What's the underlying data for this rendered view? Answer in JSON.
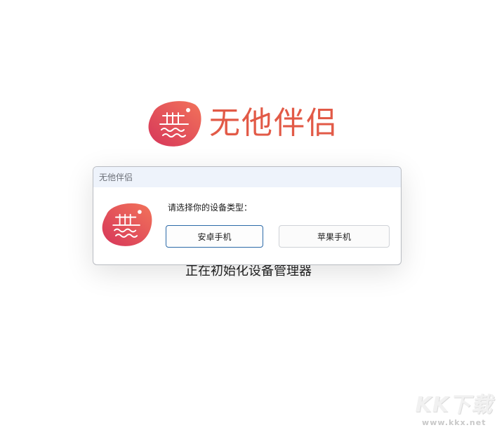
{
  "brand": {
    "name": "无他伴侣",
    "color": "#e25a47",
    "icon": "wuta-logo-icon"
  },
  "status": {
    "text": "正在初始化设备管理器"
  },
  "dialog": {
    "title": "无他伴侣",
    "prompt": "请选择你的设备类型：",
    "buttons": {
      "android": "安卓手机",
      "iphone": "苹果手机"
    },
    "icon": "wuta-logo-icon"
  },
  "watermark": {
    "logo": "KK下载",
    "url": "www.kkx.net"
  }
}
